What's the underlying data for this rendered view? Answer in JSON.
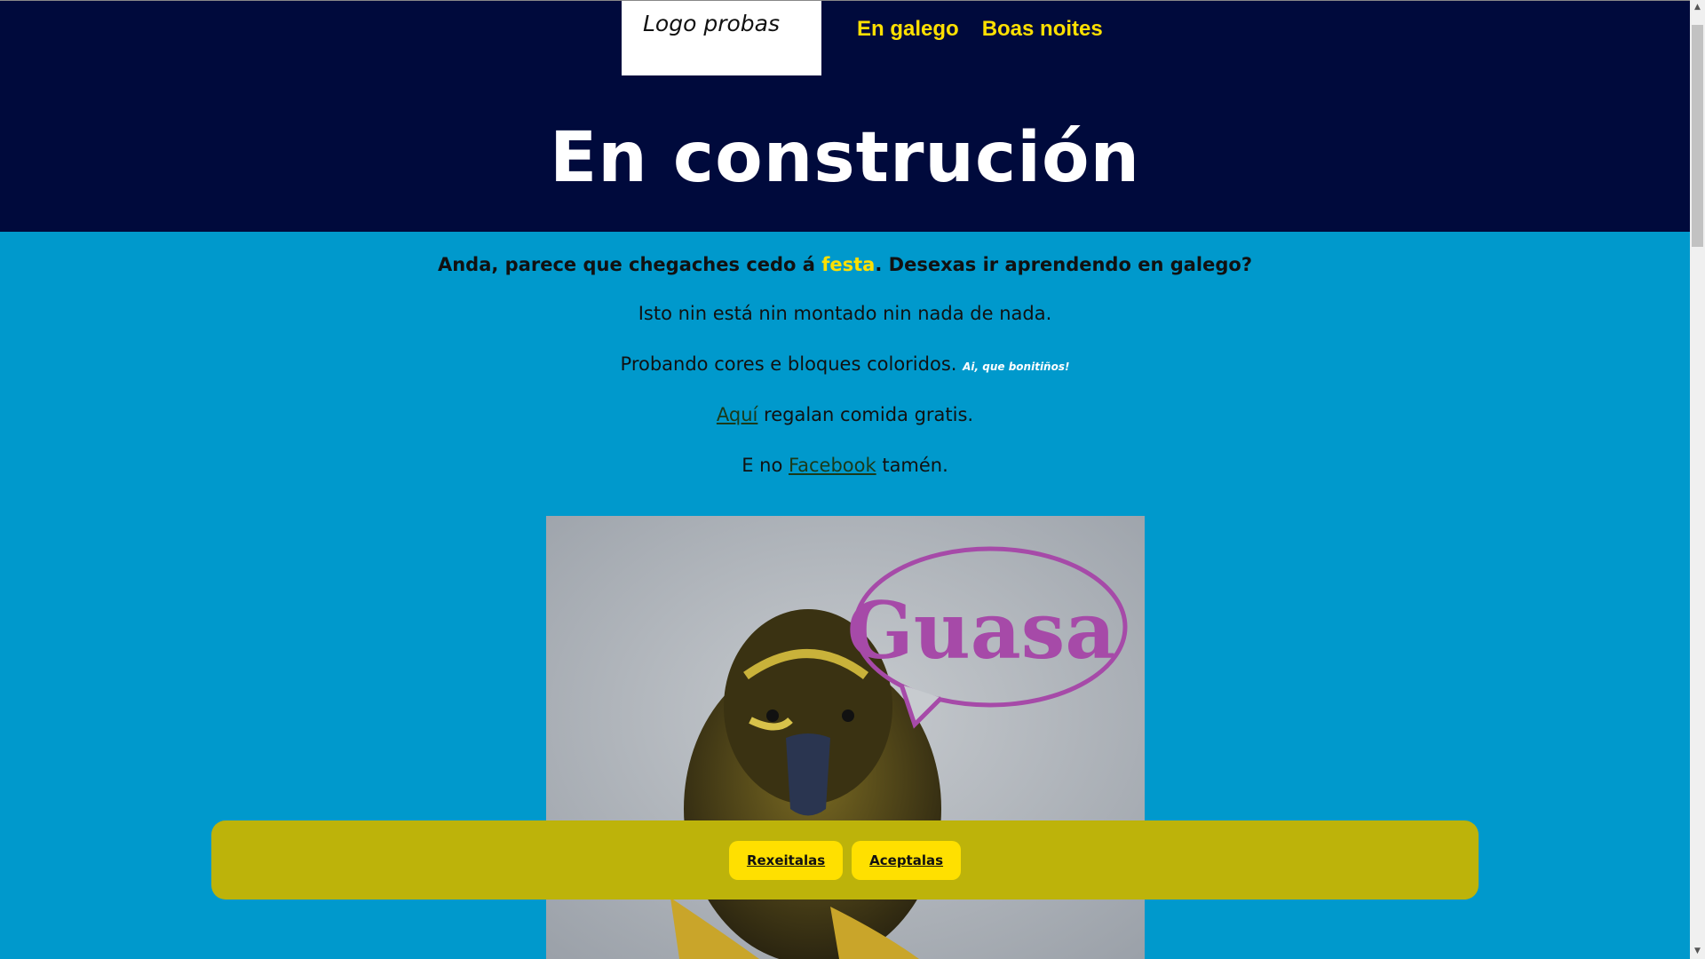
{
  "header": {
    "logo_text": "Logo probas",
    "nav": [
      "En galego",
      "Boas noites"
    ],
    "title": "En construción"
  },
  "content": {
    "line1_pre": "Anda, parece que chegaches cedo á ",
    "line1_highlight": "festa",
    "line1_post": ". Desexas ir aprendendo en galego?",
    "line2": "Isto nin está nin montado nin nada de nada.",
    "line3": "Probando cores e bloques coloridos.",
    "line3_note": "Ai, que bonitiños!",
    "line4_link": "Aquí",
    "line4_post": " regalan comida gratis.",
    "line5_pre": "E no ",
    "line5_link": "Facebook",
    "line5_post": " tamén."
  },
  "image": {
    "bubble_text": "Guasa"
  },
  "cookie_bar": {
    "reject_label": "Rexeitalas",
    "accept_label": "Aceptalas"
  },
  "colors": {
    "header_bg": "#000a3c",
    "page_bg": "#0099cc",
    "accent_yellow": "#ffe000",
    "cookie_bg": "#bdb30a"
  }
}
